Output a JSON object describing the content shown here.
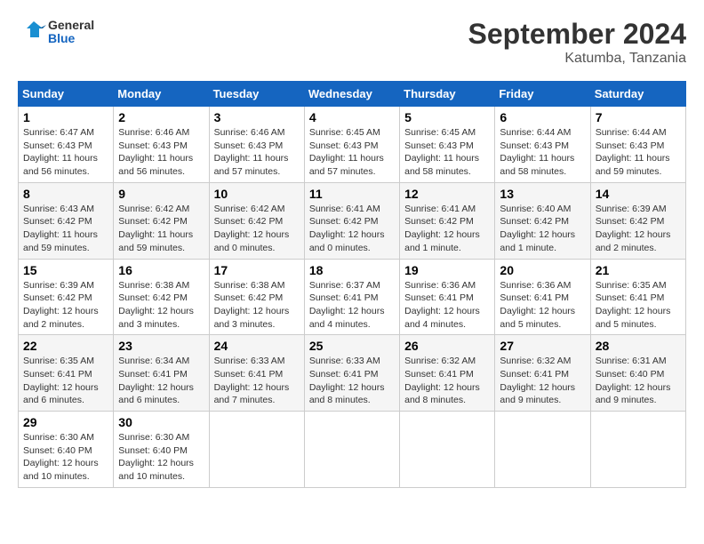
{
  "header": {
    "logo_line1": "General",
    "logo_line2": "Blue",
    "month": "September 2024",
    "location": "Katumba, Tanzania"
  },
  "days_of_week": [
    "Sunday",
    "Monday",
    "Tuesday",
    "Wednesday",
    "Thursday",
    "Friday",
    "Saturday"
  ],
  "weeks": [
    [
      {
        "day": "1",
        "info": "Sunrise: 6:47 AM\nSunset: 6:43 PM\nDaylight: 11 hours and 56 minutes."
      },
      {
        "day": "2",
        "info": "Sunrise: 6:46 AM\nSunset: 6:43 PM\nDaylight: 11 hours and 56 minutes."
      },
      {
        "day": "3",
        "info": "Sunrise: 6:46 AM\nSunset: 6:43 PM\nDaylight: 11 hours and 57 minutes."
      },
      {
        "day": "4",
        "info": "Sunrise: 6:45 AM\nSunset: 6:43 PM\nDaylight: 11 hours and 57 minutes."
      },
      {
        "day": "5",
        "info": "Sunrise: 6:45 AM\nSunset: 6:43 PM\nDaylight: 11 hours and 58 minutes."
      },
      {
        "day": "6",
        "info": "Sunrise: 6:44 AM\nSunset: 6:43 PM\nDaylight: 11 hours and 58 minutes."
      },
      {
        "day": "7",
        "info": "Sunrise: 6:44 AM\nSunset: 6:43 PM\nDaylight: 11 hours and 59 minutes."
      }
    ],
    [
      {
        "day": "8",
        "info": "Sunrise: 6:43 AM\nSunset: 6:42 PM\nDaylight: 11 hours and 59 minutes."
      },
      {
        "day": "9",
        "info": "Sunrise: 6:42 AM\nSunset: 6:42 PM\nDaylight: 11 hours and 59 minutes."
      },
      {
        "day": "10",
        "info": "Sunrise: 6:42 AM\nSunset: 6:42 PM\nDaylight: 12 hours and 0 minutes."
      },
      {
        "day": "11",
        "info": "Sunrise: 6:41 AM\nSunset: 6:42 PM\nDaylight: 12 hours and 0 minutes."
      },
      {
        "day": "12",
        "info": "Sunrise: 6:41 AM\nSunset: 6:42 PM\nDaylight: 12 hours and 1 minute."
      },
      {
        "day": "13",
        "info": "Sunrise: 6:40 AM\nSunset: 6:42 PM\nDaylight: 12 hours and 1 minute."
      },
      {
        "day": "14",
        "info": "Sunrise: 6:39 AM\nSunset: 6:42 PM\nDaylight: 12 hours and 2 minutes."
      }
    ],
    [
      {
        "day": "15",
        "info": "Sunrise: 6:39 AM\nSunset: 6:42 PM\nDaylight: 12 hours and 2 minutes."
      },
      {
        "day": "16",
        "info": "Sunrise: 6:38 AM\nSunset: 6:42 PM\nDaylight: 12 hours and 3 minutes."
      },
      {
        "day": "17",
        "info": "Sunrise: 6:38 AM\nSunset: 6:42 PM\nDaylight: 12 hours and 3 minutes."
      },
      {
        "day": "18",
        "info": "Sunrise: 6:37 AM\nSunset: 6:41 PM\nDaylight: 12 hours and 4 minutes."
      },
      {
        "day": "19",
        "info": "Sunrise: 6:36 AM\nSunset: 6:41 PM\nDaylight: 12 hours and 4 minutes."
      },
      {
        "day": "20",
        "info": "Sunrise: 6:36 AM\nSunset: 6:41 PM\nDaylight: 12 hours and 5 minutes."
      },
      {
        "day": "21",
        "info": "Sunrise: 6:35 AM\nSunset: 6:41 PM\nDaylight: 12 hours and 5 minutes."
      }
    ],
    [
      {
        "day": "22",
        "info": "Sunrise: 6:35 AM\nSunset: 6:41 PM\nDaylight: 12 hours and 6 minutes."
      },
      {
        "day": "23",
        "info": "Sunrise: 6:34 AM\nSunset: 6:41 PM\nDaylight: 12 hours and 6 minutes."
      },
      {
        "day": "24",
        "info": "Sunrise: 6:33 AM\nSunset: 6:41 PM\nDaylight: 12 hours and 7 minutes."
      },
      {
        "day": "25",
        "info": "Sunrise: 6:33 AM\nSunset: 6:41 PM\nDaylight: 12 hours and 8 minutes."
      },
      {
        "day": "26",
        "info": "Sunrise: 6:32 AM\nSunset: 6:41 PM\nDaylight: 12 hours and 8 minutes."
      },
      {
        "day": "27",
        "info": "Sunrise: 6:32 AM\nSunset: 6:41 PM\nDaylight: 12 hours and 9 minutes."
      },
      {
        "day": "28",
        "info": "Sunrise: 6:31 AM\nSunset: 6:40 PM\nDaylight: 12 hours and 9 minutes."
      }
    ],
    [
      {
        "day": "29",
        "info": "Sunrise: 6:30 AM\nSunset: 6:40 PM\nDaylight: 12 hours and 10 minutes."
      },
      {
        "day": "30",
        "info": "Sunrise: 6:30 AM\nSunset: 6:40 PM\nDaylight: 12 hours and 10 minutes."
      },
      null,
      null,
      null,
      null,
      null
    ]
  ]
}
